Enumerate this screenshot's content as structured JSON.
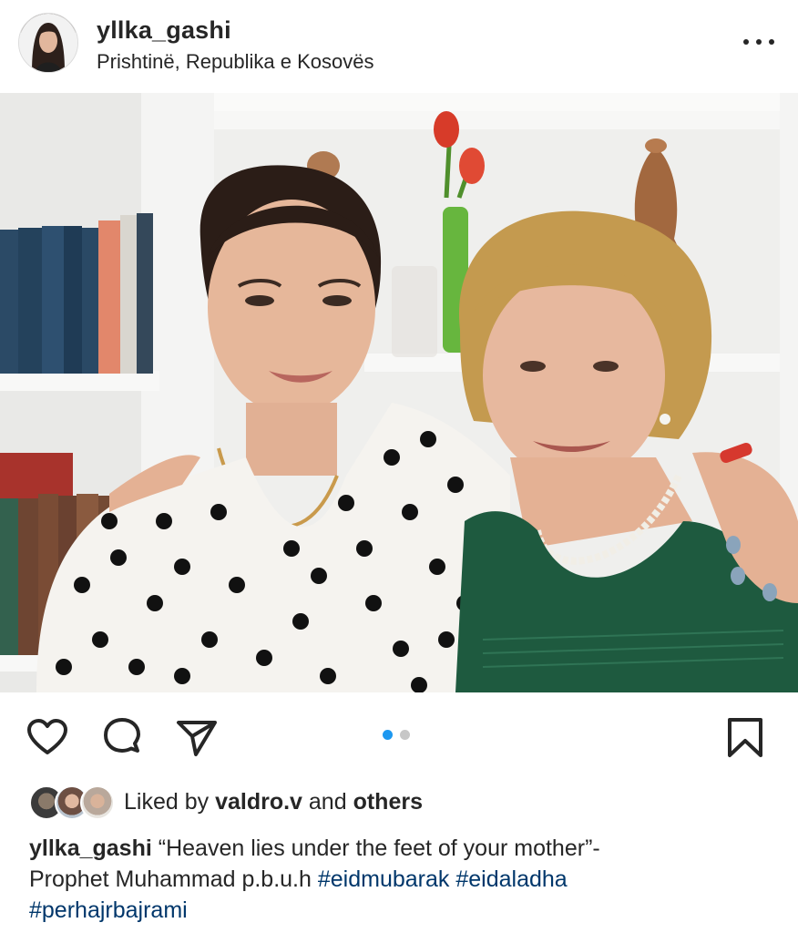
{
  "post": {
    "username": "yllka_gashi",
    "location": "Prishtinë, Republika e Kosovës",
    "more_icon": "more-horizontal-icon"
  },
  "actions": {
    "like_icon": "heart-icon",
    "comment_icon": "comment-icon",
    "share_icon": "send-icon",
    "save_icon": "bookmark-icon",
    "carousel": {
      "count": 2,
      "active_index": 0
    },
    "active_color": "#1d98f0"
  },
  "likes": {
    "prefix": "Liked by",
    "user": "valdro.v",
    "middle": "and",
    "others": "others"
  },
  "caption": {
    "username": "yllka_gashi",
    "text_line1": " “Heaven lies under the feet of your mother”-",
    "text_line2": "Prophet Muhammad p.b.u.h ",
    "hashtags": [
      "#eidmubarak",
      "#eidaladha",
      "#perhajrbajrami"
    ],
    "hashtag_color": "#00376b"
  }
}
